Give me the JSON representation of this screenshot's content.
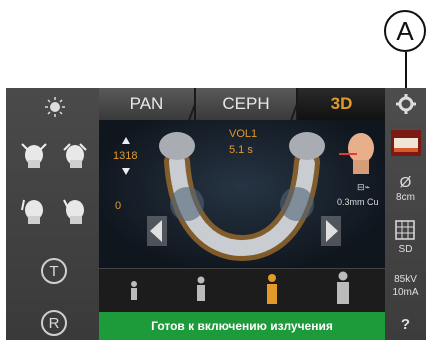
{
  "callout": {
    "label": "A"
  },
  "tabs": [
    {
      "label": "PAN"
    },
    {
      "label": "CEPH"
    },
    {
      "label": "3D",
      "active": true
    }
  ],
  "viewer": {
    "height_value": "1318",
    "zero_value": "0",
    "vol_label": "VOL1",
    "time_label": "5.1 s",
    "filter_label": "0.3mm Cu"
  },
  "left_panel": {
    "rotate_t_label": "T",
    "rotate_r_label": "R"
  },
  "right_panel": {
    "fov_label": "8cm",
    "resolution_label": "SD",
    "kv_label": "85kV",
    "ma_label": "10mA",
    "help_label": "?"
  },
  "status": {
    "message": "Готов к включению излучения"
  },
  "colors": {
    "accent": "#e39a2b",
    "status_green": "#1d9a3a",
    "panel": "#3a3a3a"
  }
}
